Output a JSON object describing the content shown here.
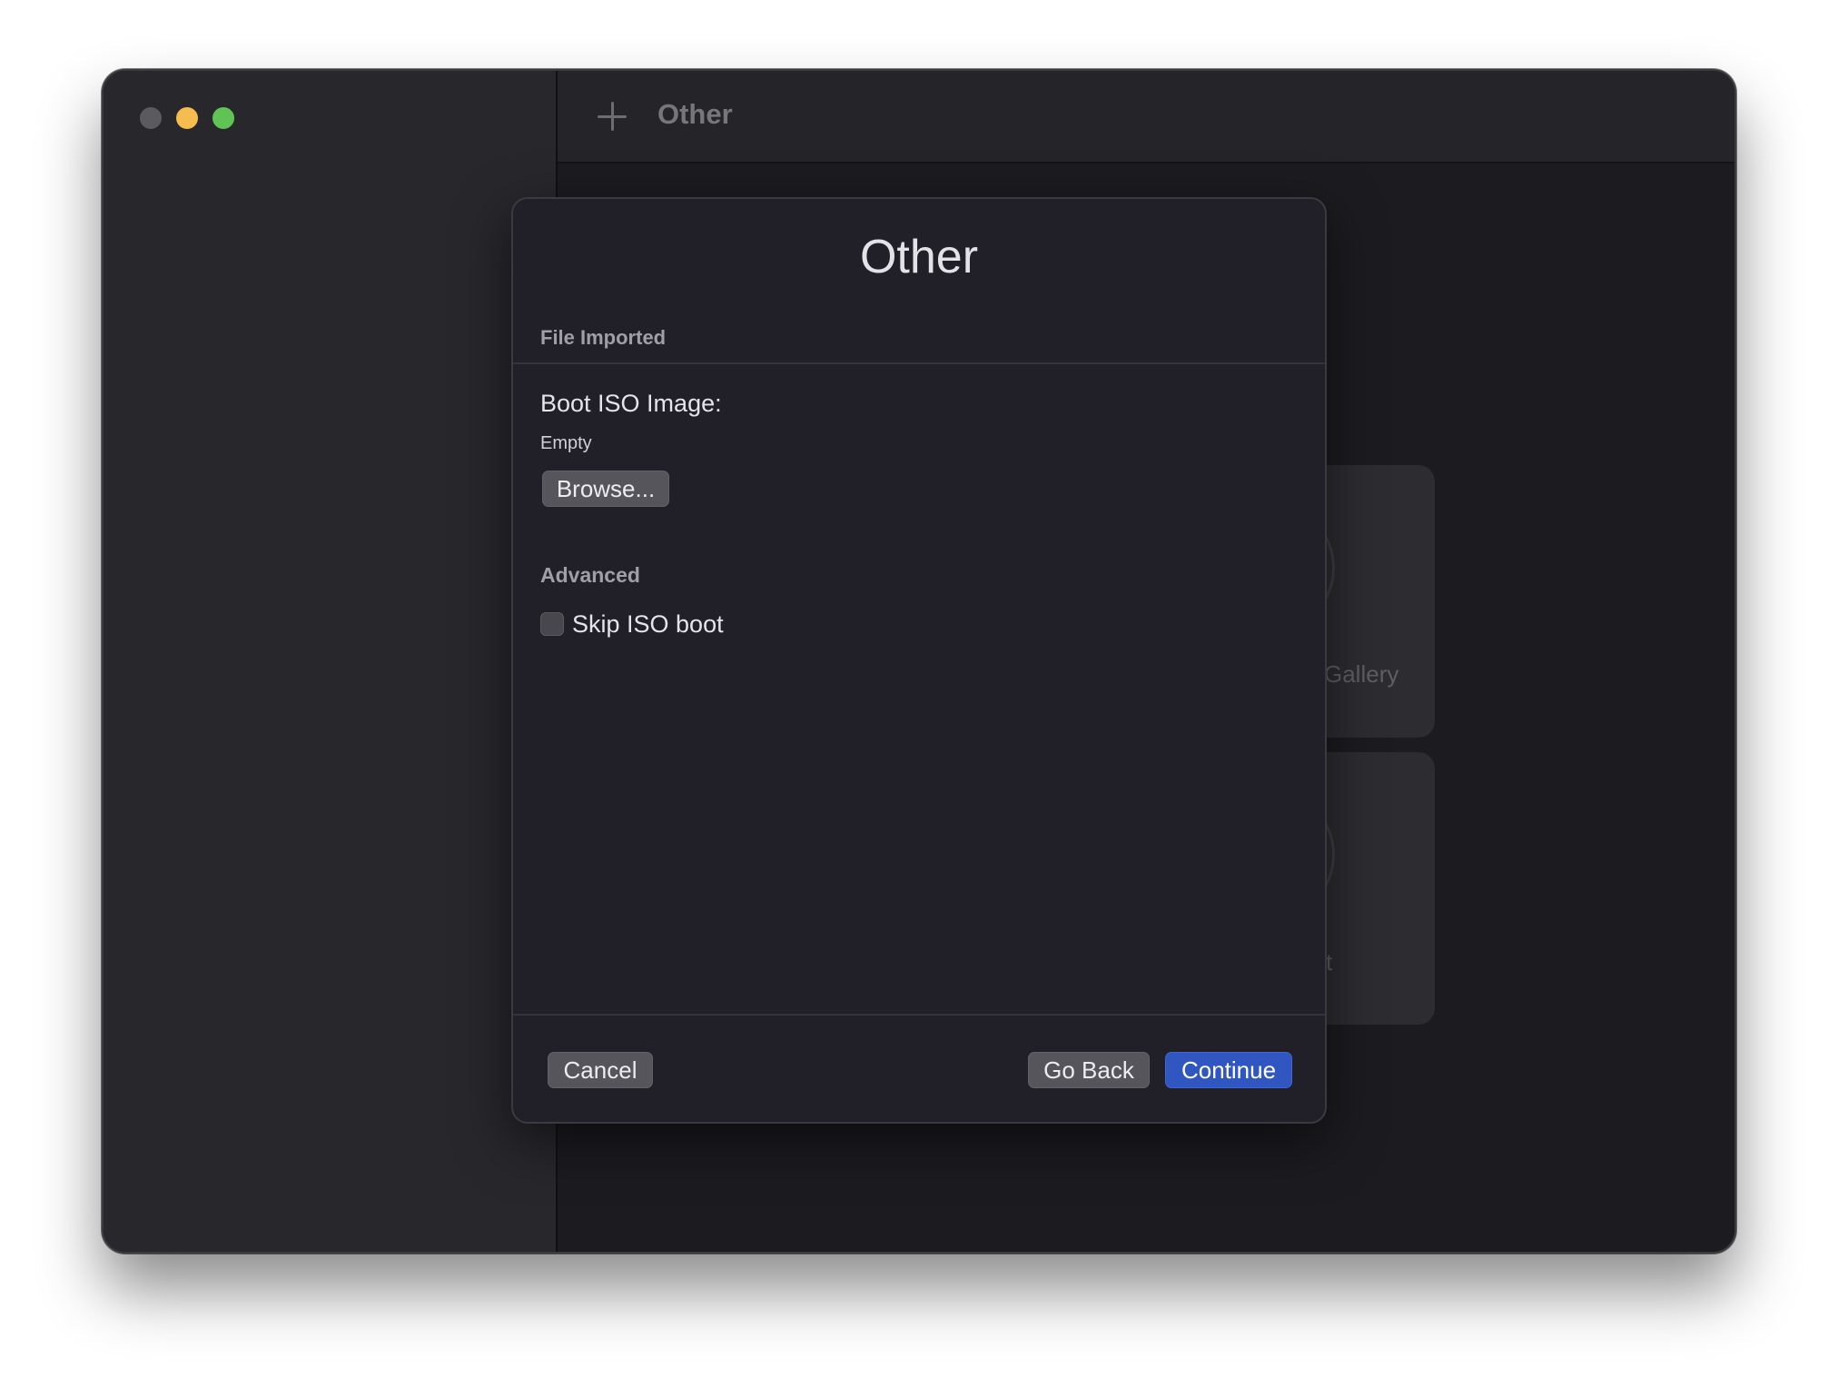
{
  "toolbar": {
    "title": "Other"
  },
  "background_cards": [
    {
      "label": "Gallery"
    },
    {
      "label": "t"
    }
  ],
  "dialog": {
    "title": "Other",
    "section_header": "File Imported",
    "boot_iso": {
      "label": "Boot ISO Image:",
      "value": "Empty",
      "browse_label": "Browse..."
    },
    "advanced": {
      "header": "Advanced",
      "skip_iso_boot": {
        "label": "Skip ISO boot",
        "checked": false
      }
    },
    "buttons": {
      "cancel": "Cancel",
      "go_back": "Go Back",
      "continue": "Continue"
    }
  },
  "colors": {
    "accent": "#2f56c1",
    "traffic_close": "#5b5a5f",
    "traffic_minimize": "#f5bd4f",
    "traffic_maximize": "#5fc454"
  }
}
